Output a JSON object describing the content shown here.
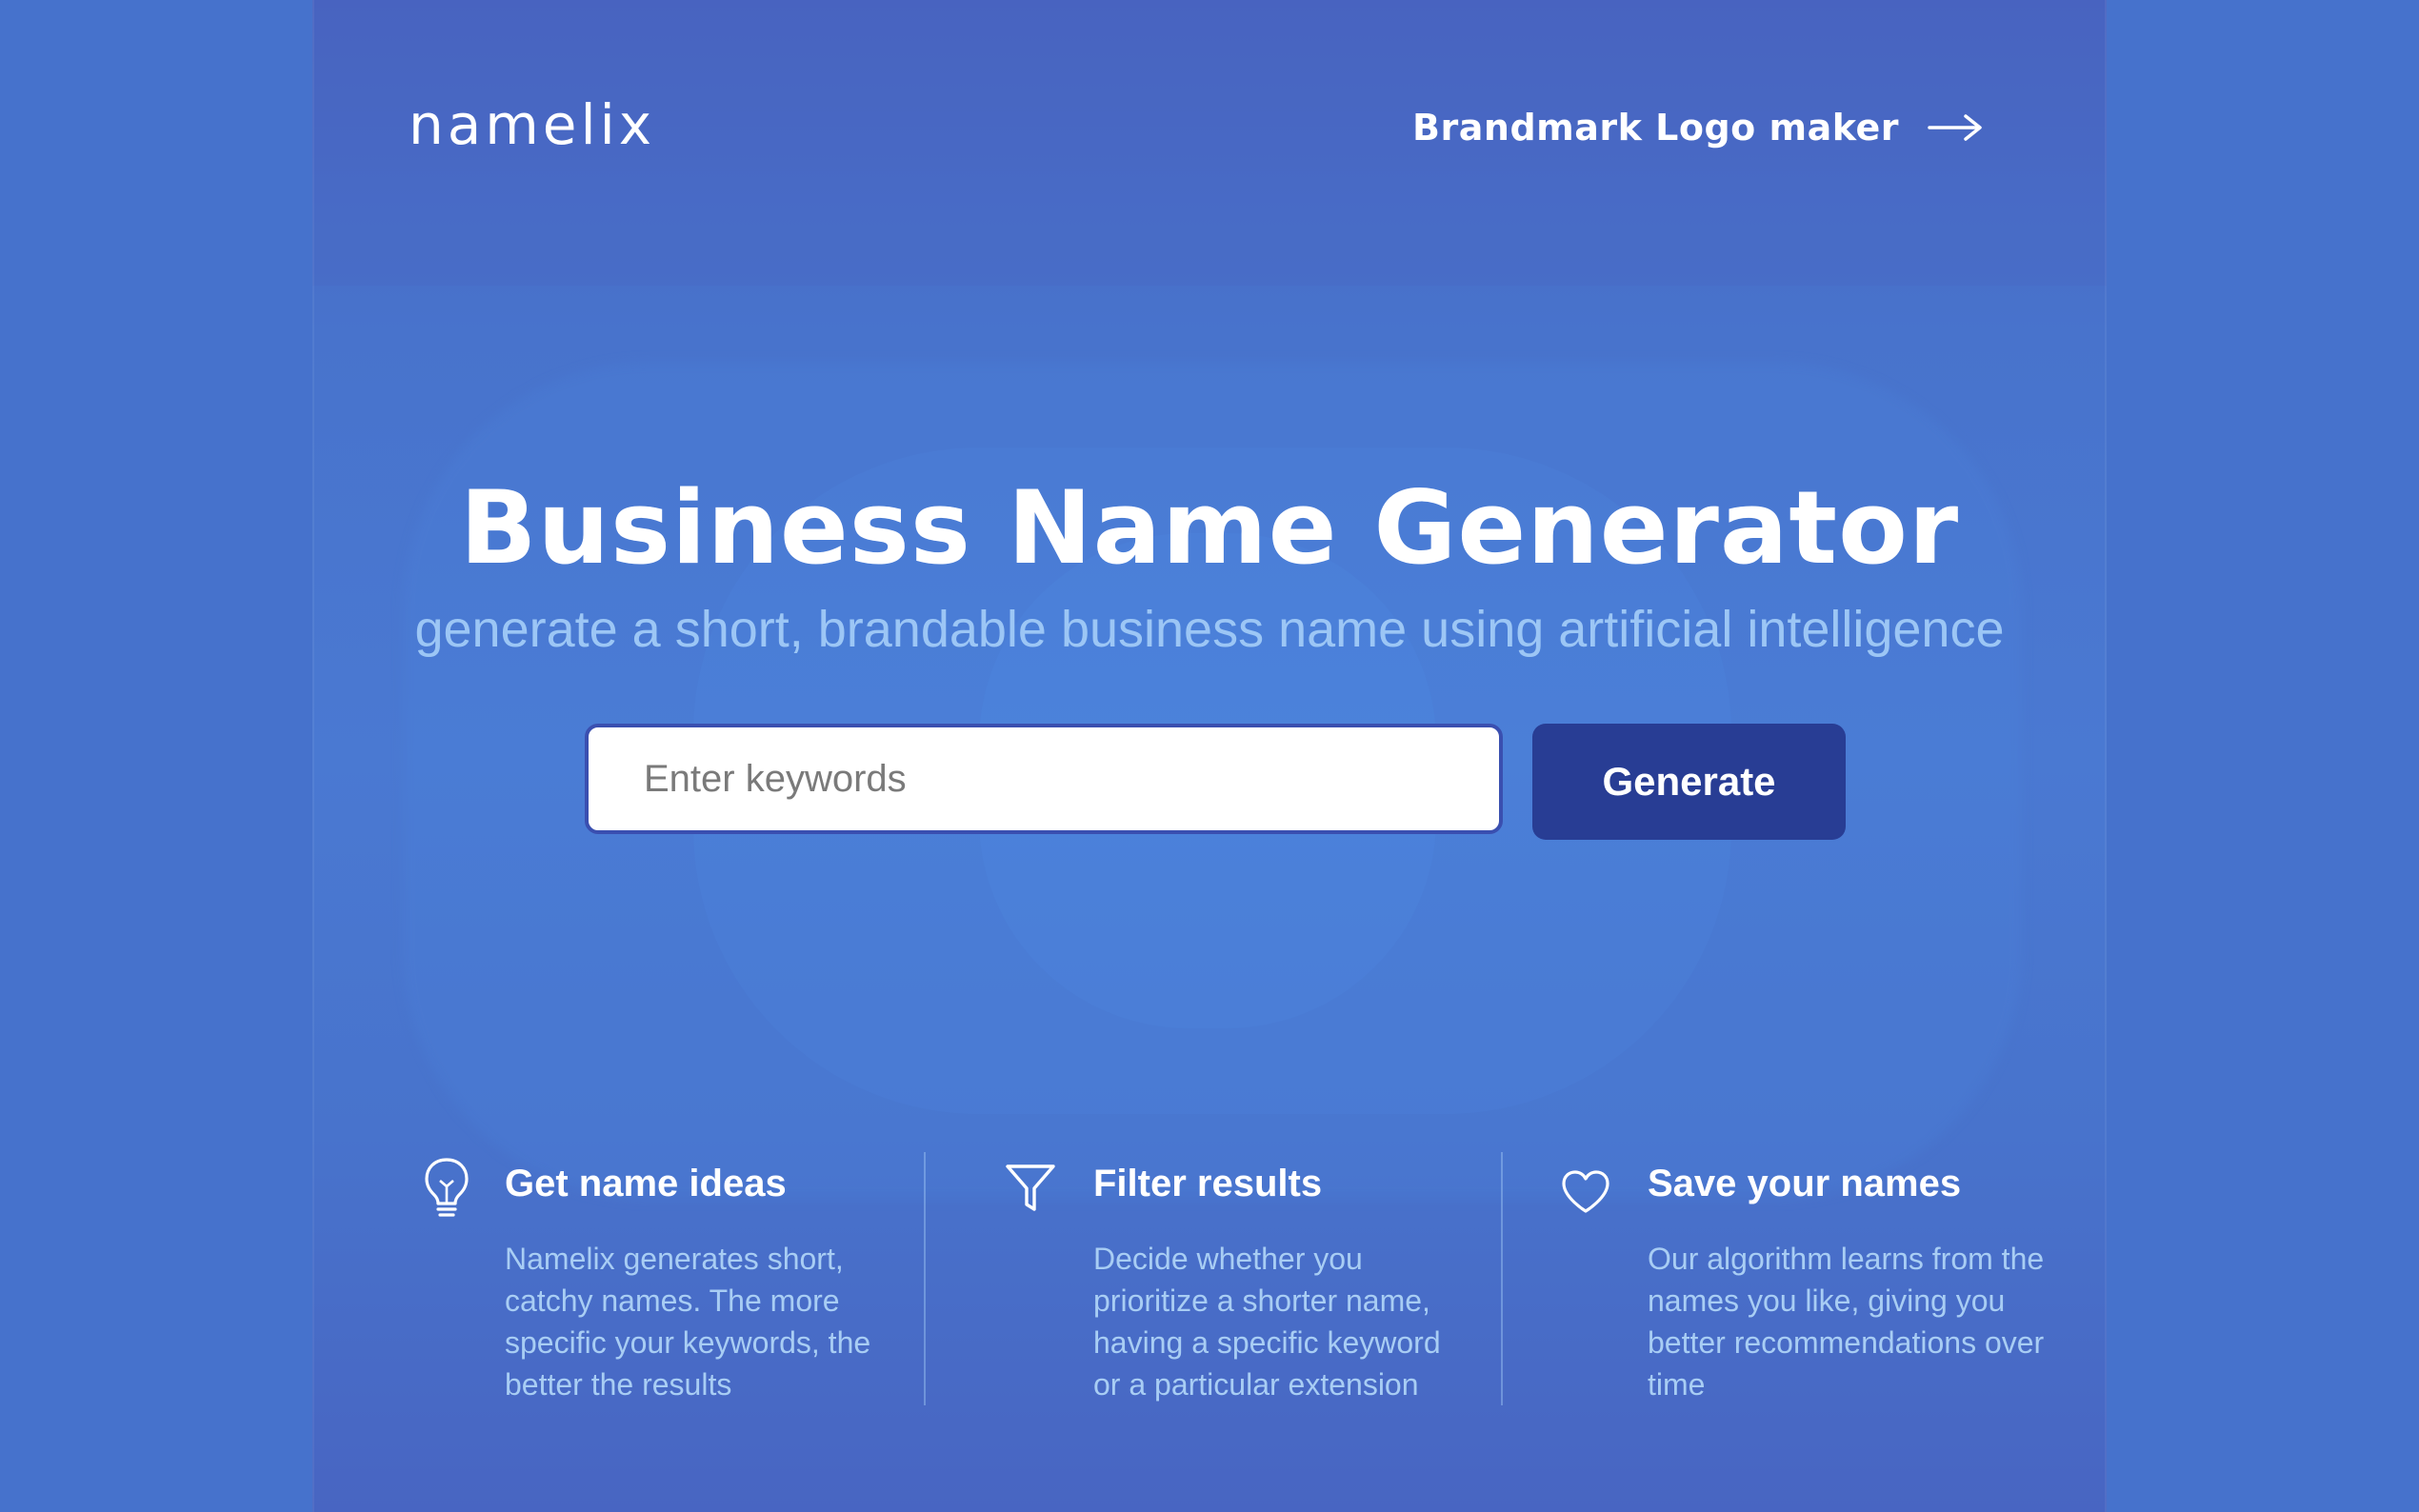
{
  "header": {
    "logo_text": "namelix",
    "brandmark_link": {
      "label": "Brandmark Logo maker",
      "icon": "arrow-right-icon"
    }
  },
  "hero": {
    "title": "Business Name Generator",
    "subtitle": "generate a short, brandable business name using artificial intelligence"
  },
  "search": {
    "value": "",
    "placeholder": "Enter keywords",
    "button_label": "Generate"
  },
  "features": [
    {
      "icon": "lightbulb-icon",
      "title": "Get name ideas",
      "description": "Namelix generates short, catchy names. The more specific your keywords, the better the results"
    },
    {
      "icon": "filter-icon",
      "title": "Filter results",
      "description": "Decide whether you prioritize a shorter name, having a specific keyword or a particular extension"
    },
    {
      "icon": "heart-icon",
      "title": "Save your names",
      "description": "Our algorithm learns from the names you like, giving you better recommendations over time"
    }
  ],
  "colors": {
    "background": "#4672cc",
    "button": "#283d94",
    "input_border": "#3a4fb0",
    "subtitle": "#9cc6f5",
    "feature_text": "#a8cdf4"
  }
}
